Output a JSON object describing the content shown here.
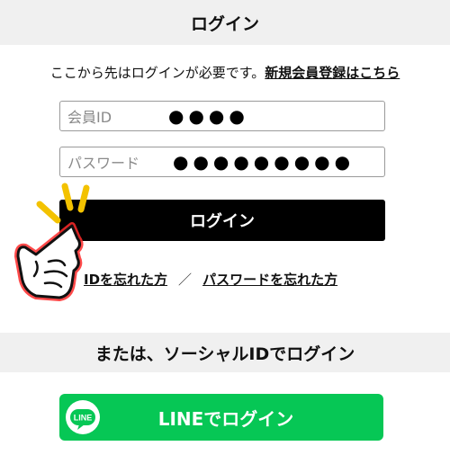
{
  "login_section": {
    "title": "ログイン",
    "intro_text": "ここから先はログインが必要です。",
    "register_link": "新規会員登録はこちら",
    "id_field": {
      "placeholder": "会員ID",
      "value_masked": "●●●●"
    },
    "password_field": {
      "placeholder": "パスワード",
      "value_masked": "●●●●●●●●●"
    },
    "login_button": "ログイン",
    "forgot_id_link": "IDを忘れた方",
    "separator": "／",
    "forgot_password_link": "パスワードを忘れた方"
  },
  "alt_section": {
    "title": "または、ソーシャルIDでログイン",
    "line_button": "LINEでログイン",
    "line_logo_text": "LINE"
  },
  "colors": {
    "line_green": "#06c755",
    "header_bg": "#f0f0f0",
    "button_black": "#000000"
  },
  "icons": [
    "line-logo-icon",
    "pointing-hand-icon"
  ]
}
